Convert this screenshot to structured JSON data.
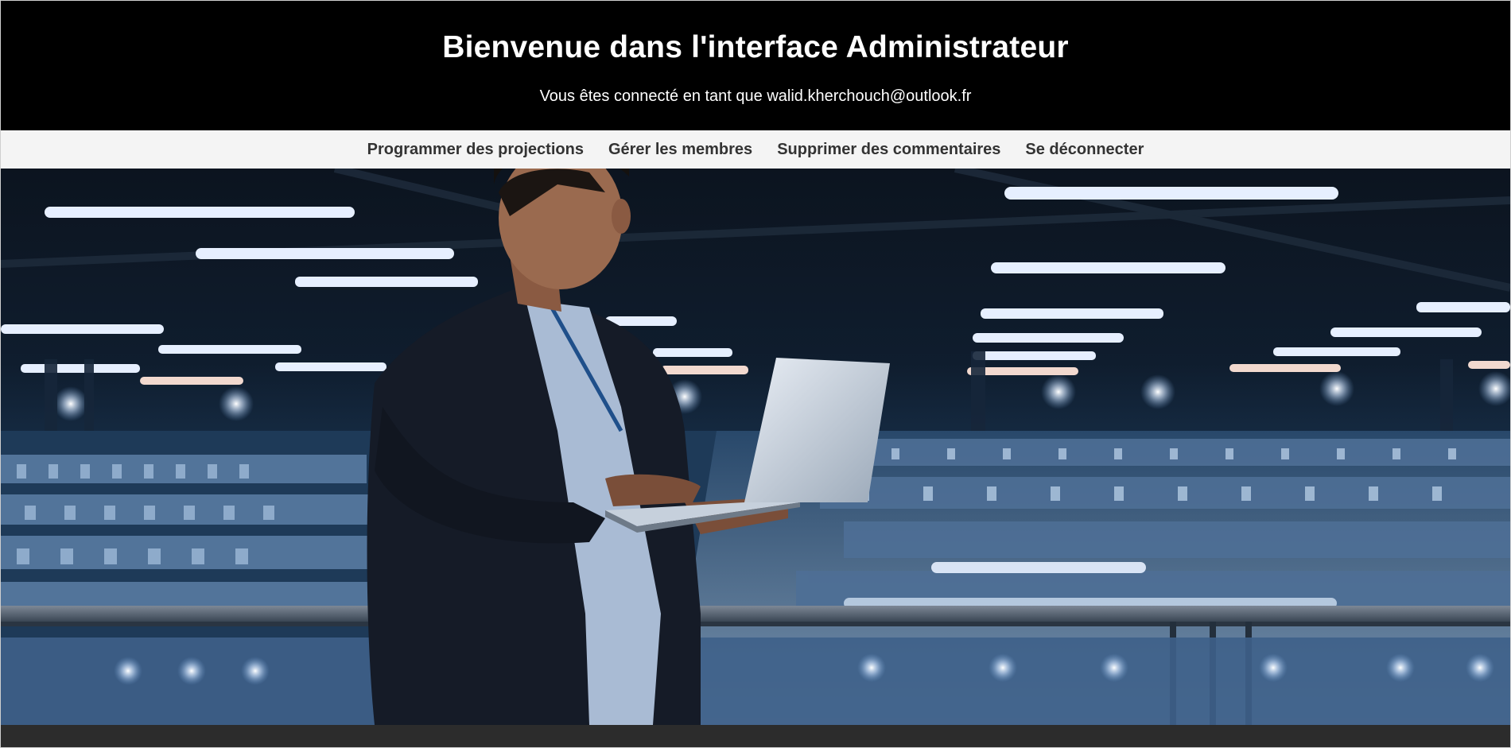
{
  "header": {
    "title": "Bienvenue dans l'interface Administrateur",
    "subtitle": "Vous êtes connecté en tant que walid.kherchouch@outlook.fr"
  },
  "nav": {
    "items": [
      {
        "label": "Programmer des projections"
      },
      {
        "label": "Gérer les membres"
      },
      {
        "label": "Supprimer des commentaires"
      },
      {
        "label": "Se déconnecter"
      }
    ]
  },
  "colors": {
    "header_bg": "#000000",
    "header_text": "#ffffff",
    "nav_bg": "#f4f4f4",
    "nav_text": "#333333",
    "footer_bg": "#2c2c2c"
  }
}
